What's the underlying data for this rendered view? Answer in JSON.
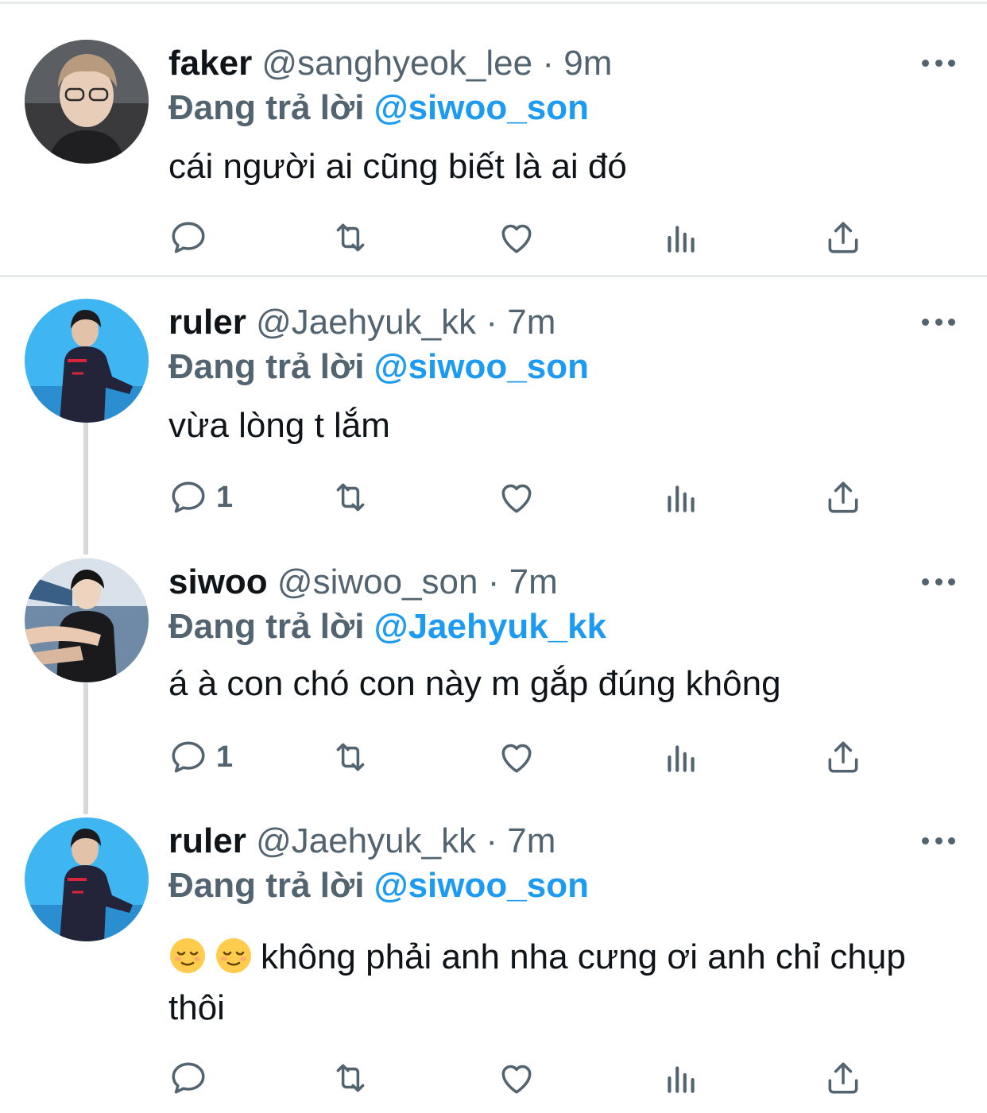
{
  "tweets": [
    {
      "name": "faker",
      "handle": "@sanghyeok_lee",
      "separator": "·",
      "time": "9m",
      "reply_prefix": "Đang trả lời",
      "reply_to": "@siwoo_son",
      "text": "cái người ai cũng biết là ai đó",
      "reply_count": ""
    },
    {
      "name": "ruler",
      "handle": "@Jaehyuk_kk",
      "separator": "·",
      "time": "7m",
      "reply_prefix": "Đang trả lời",
      "reply_to": "@siwoo_son",
      "text": "vừa lòng t lắm",
      "reply_count": "1"
    },
    {
      "name": "siwoo",
      "handle": "@siwoo_son",
      "separator": "·",
      "time": "7m",
      "reply_prefix": "Đang trả lời",
      "reply_to": "@Jaehyuk_kk",
      "text": "á à con chó con này m gắp đúng không",
      "reply_count": "1"
    },
    {
      "name": "ruler",
      "handle": "@Jaehyuk_kk",
      "separator": "·",
      "time": "7m",
      "reply_prefix": "Đang trả lời",
      "reply_to": "@siwoo_son",
      "text": "không phải anh nha cưng ơi anh chỉ chụp thôi",
      "reply_count": ""
    }
  ],
  "icons": {
    "reply": "reply-icon",
    "retweet": "retweet-icon",
    "like": "heart-icon",
    "views": "views-icon",
    "share": "share-icon",
    "more": "more-icon",
    "emoji": "relieved-face-emoji"
  },
  "colors": {
    "accent": "#1d9bf0",
    "secondary_text": "#536471",
    "primary_text": "#0f1419",
    "divider": "#e7e9eb",
    "thread_line": "#d6d9dc"
  }
}
